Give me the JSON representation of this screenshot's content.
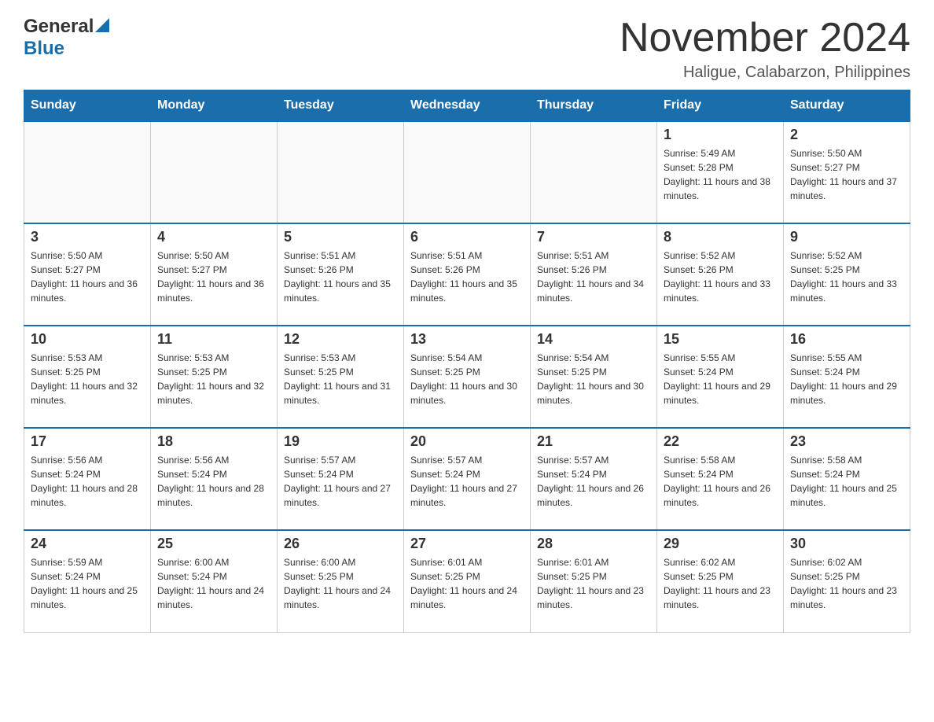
{
  "header": {
    "logo": {
      "general": "General",
      "blue": "Blue"
    },
    "title": "November 2024",
    "subtitle": "Haligue, Calabarzon, Philippines"
  },
  "calendar": {
    "days": [
      "Sunday",
      "Monday",
      "Tuesday",
      "Wednesday",
      "Thursday",
      "Friday",
      "Saturday"
    ],
    "weeks": [
      {
        "cells": [
          {
            "day": "",
            "info": ""
          },
          {
            "day": "",
            "info": ""
          },
          {
            "day": "",
            "info": ""
          },
          {
            "day": "",
            "info": ""
          },
          {
            "day": "",
            "info": ""
          },
          {
            "day": "1",
            "info": "Sunrise: 5:49 AM\nSunset: 5:28 PM\nDaylight: 11 hours and 38 minutes."
          },
          {
            "day": "2",
            "info": "Sunrise: 5:50 AM\nSunset: 5:27 PM\nDaylight: 11 hours and 37 minutes."
          }
        ]
      },
      {
        "cells": [
          {
            "day": "3",
            "info": "Sunrise: 5:50 AM\nSunset: 5:27 PM\nDaylight: 11 hours and 36 minutes."
          },
          {
            "day": "4",
            "info": "Sunrise: 5:50 AM\nSunset: 5:27 PM\nDaylight: 11 hours and 36 minutes."
          },
          {
            "day": "5",
            "info": "Sunrise: 5:51 AM\nSunset: 5:26 PM\nDaylight: 11 hours and 35 minutes."
          },
          {
            "day": "6",
            "info": "Sunrise: 5:51 AM\nSunset: 5:26 PM\nDaylight: 11 hours and 35 minutes."
          },
          {
            "day": "7",
            "info": "Sunrise: 5:51 AM\nSunset: 5:26 PM\nDaylight: 11 hours and 34 minutes."
          },
          {
            "day": "8",
            "info": "Sunrise: 5:52 AM\nSunset: 5:26 PM\nDaylight: 11 hours and 33 minutes."
          },
          {
            "day": "9",
            "info": "Sunrise: 5:52 AM\nSunset: 5:25 PM\nDaylight: 11 hours and 33 minutes."
          }
        ]
      },
      {
        "cells": [
          {
            "day": "10",
            "info": "Sunrise: 5:53 AM\nSunset: 5:25 PM\nDaylight: 11 hours and 32 minutes."
          },
          {
            "day": "11",
            "info": "Sunrise: 5:53 AM\nSunset: 5:25 PM\nDaylight: 11 hours and 32 minutes."
          },
          {
            "day": "12",
            "info": "Sunrise: 5:53 AM\nSunset: 5:25 PM\nDaylight: 11 hours and 31 minutes."
          },
          {
            "day": "13",
            "info": "Sunrise: 5:54 AM\nSunset: 5:25 PM\nDaylight: 11 hours and 30 minutes."
          },
          {
            "day": "14",
            "info": "Sunrise: 5:54 AM\nSunset: 5:25 PM\nDaylight: 11 hours and 30 minutes."
          },
          {
            "day": "15",
            "info": "Sunrise: 5:55 AM\nSunset: 5:24 PM\nDaylight: 11 hours and 29 minutes."
          },
          {
            "day": "16",
            "info": "Sunrise: 5:55 AM\nSunset: 5:24 PM\nDaylight: 11 hours and 29 minutes."
          }
        ]
      },
      {
        "cells": [
          {
            "day": "17",
            "info": "Sunrise: 5:56 AM\nSunset: 5:24 PM\nDaylight: 11 hours and 28 minutes."
          },
          {
            "day": "18",
            "info": "Sunrise: 5:56 AM\nSunset: 5:24 PM\nDaylight: 11 hours and 28 minutes."
          },
          {
            "day": "19",
            "info": "Sunrise: 5:57 AM\nSunset: 5:24 PM\nDaylight: 11 hours and 27 minutes."
          },
          {
            "day": "20",
            "info": "Sunrise: 5:57 AM\nSunset: 5:24 PM\nDaylight: 11 hours and 27 minutes."
          },
          {
            "day": "21",
            "info": "Sunrise: 5:57 AM\nSunset: 5:24 PM\nDaylight: 11 hours and 26 minutes."
          },
          {
            "day": "22",
            "info": "Sunrise: 5:58 AM\nSunset: 5:24 PM\nDaylight: 11 hours and 26 minutes."
          },
          {
            "day": "23",
            "info": "Sunrise: 5:58 AM\nSunset: 5:24 PM\nDaylight: 11 hours and 25 minutes."
          }
        ]
      },
      {
        "cells": [
          {
            "day": "24",
            "info": "Sunrise: 5:59 AM\nSunset: 5:24 PM\nDaylight: 11 hours and 25 minutes."
          },
          {
            "day": "25",
            "info": "Sunrise: 6:00 AM\nSunset: 5:24 PM\nDaylight: 11 hours and 24 minutes."
          },
          {
            "day": "26",
            "info": "Sunrise: 6:00 AM\nSunset: 5:25 PM\nDaylight: 11 hours and 24 minutes."
          },
          {
            "day": "27",
            "info": "Sunrise: 6:01 AM\nSunset: 5:25 PM\nDaylight: 11 hours and 24 minutes."
          },
          {
            "day": "28",
            "info": "Sunrise: 6:01 AM\nSunset: 5:25 PM\nDaylight: 11 hours and 23 minutes."
          },
          {
            "day": "29",
            "info": "Sunrise: 6:02 AM\nSunset: 5:25 PM\nDaylight: 11 hours and 23 minutes."
          },
          {
            "day": "30",
            "info": "Sunrise: 6:02 AM\nSunset: 5:25 PM\nDaylight: 11 hours and 23 minutes."
          }
        ]
      }
    ]
  }
}
